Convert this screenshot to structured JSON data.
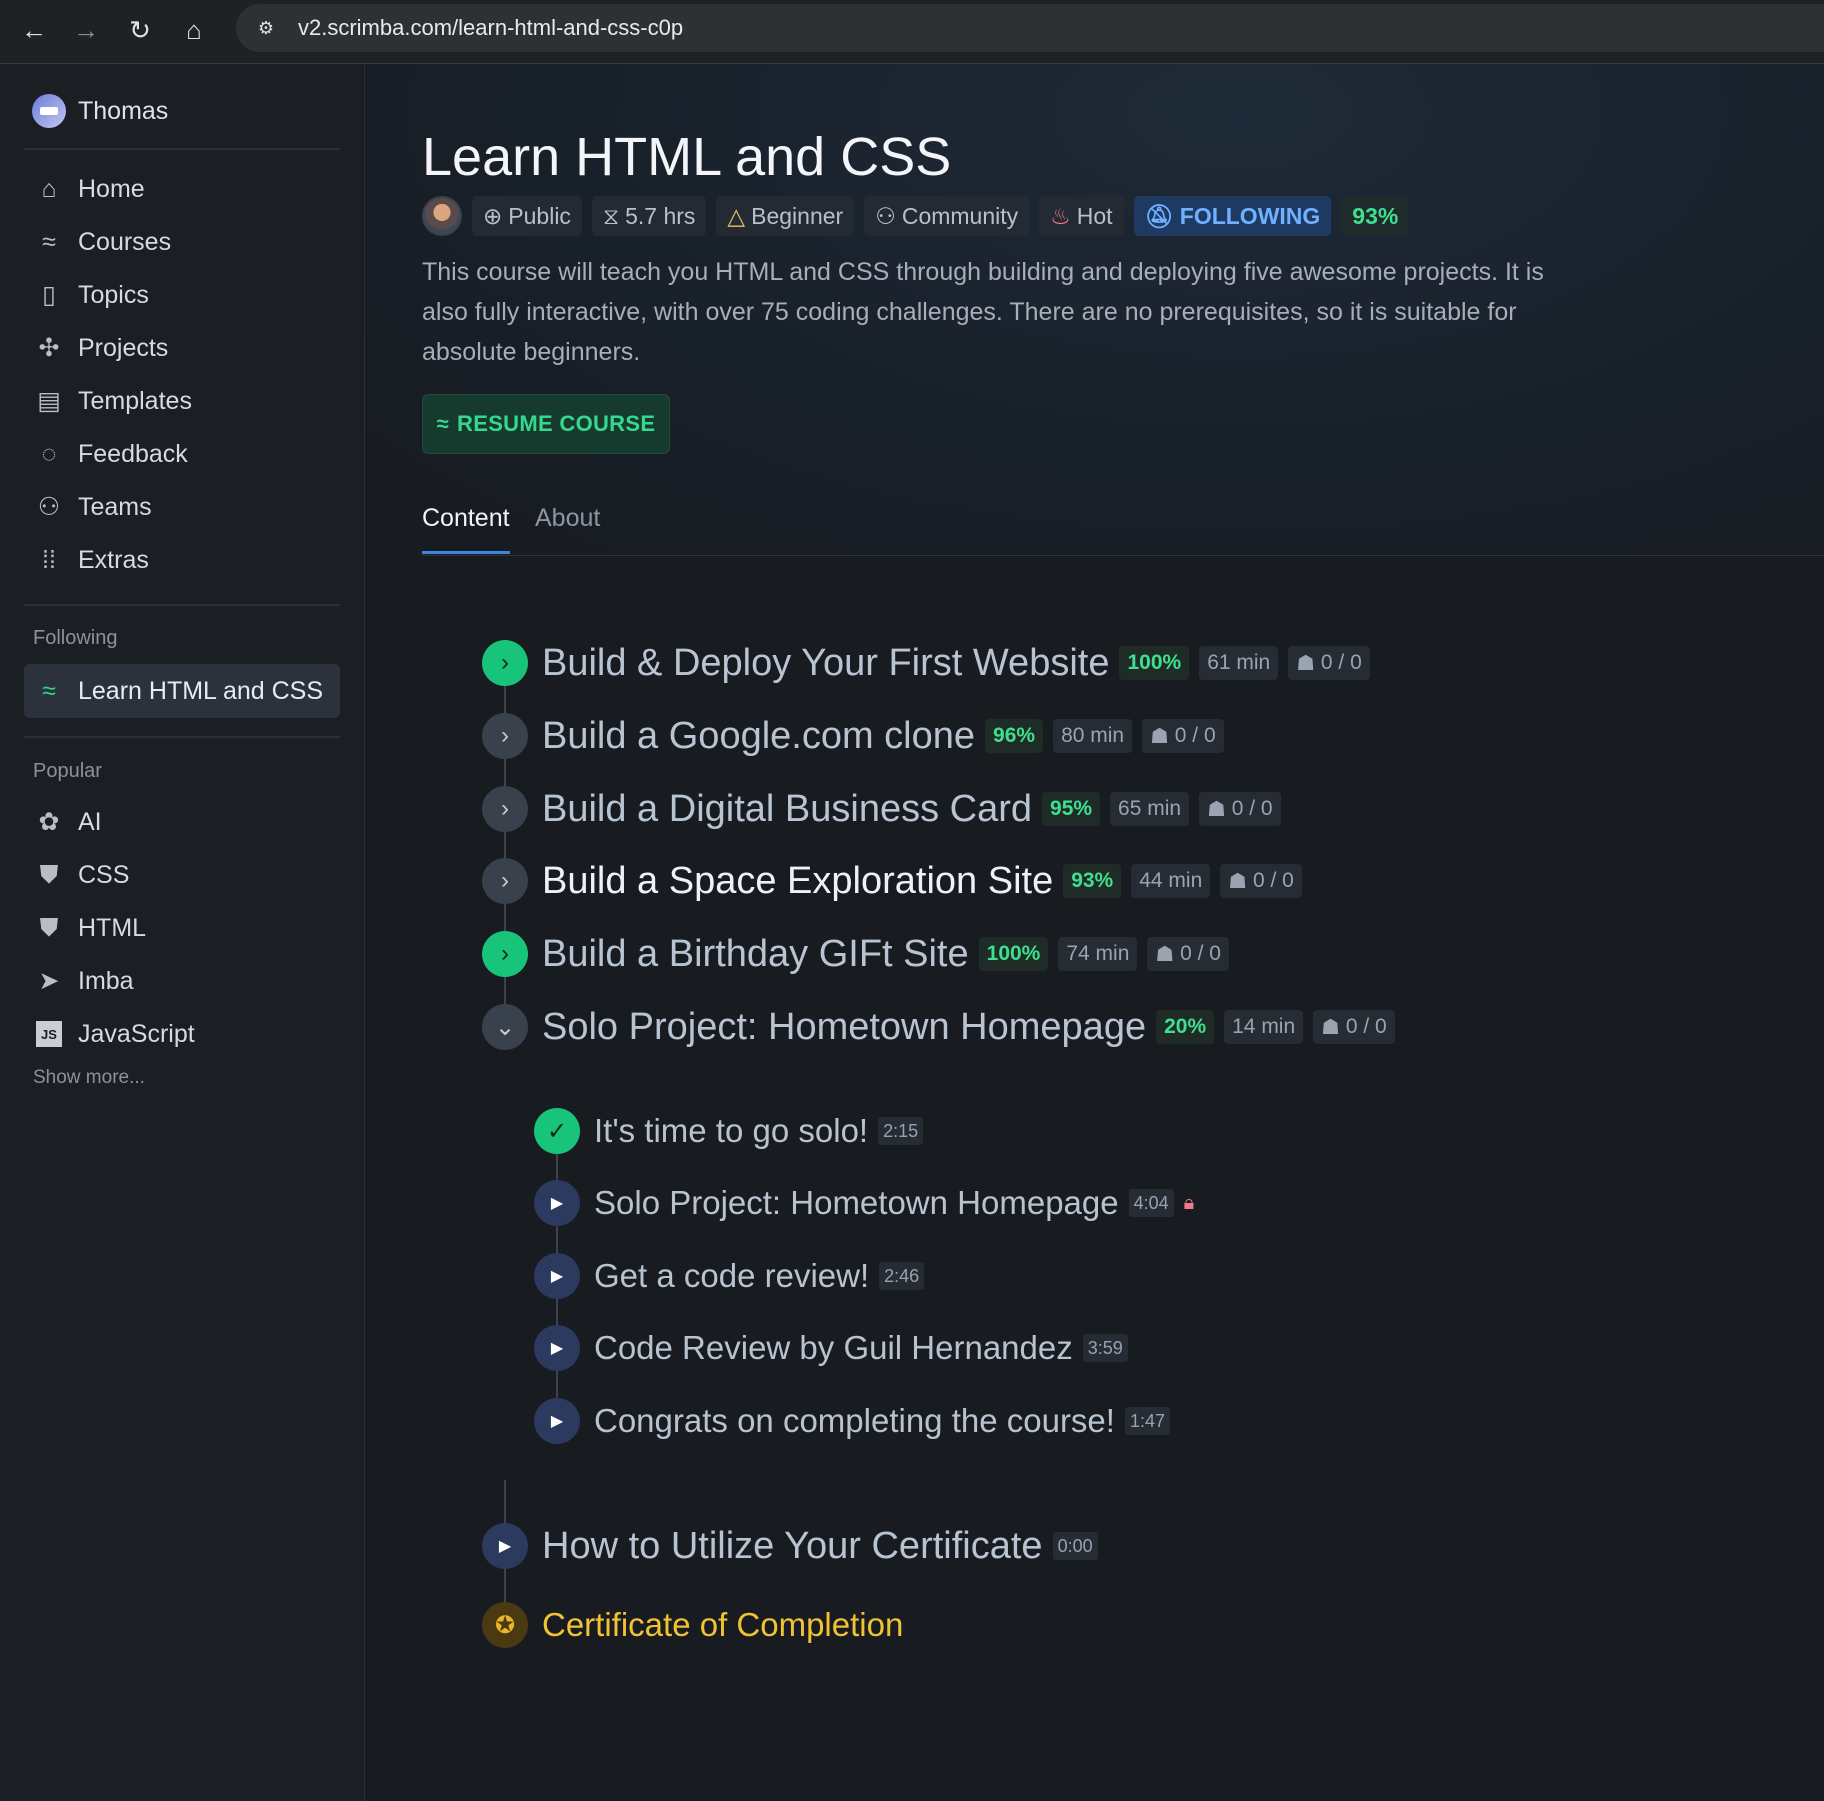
{
  "browser": {
    "url": "v2.scrimba.com/learn-html-and-css-c0p"
  },
  "sidebar": {
    "user": "Thomas",
    "nav": [
      {
        "label": "Home",
        "icon": "home-icon"
      },
      {
        "label": "Courses",
        "icon": "courses-icon"
      },
      {
        "label": "Topics",
        "icon": "topics-icon"
      },
      {
        "label": "Projects",
        "icon": "projects-icon"
      },
      {
        "label": "Templates",
        "icon": "templates-icon"
      },
      {
        "label": "Feedback",
        "icon": "feedback-icon"
      },
      {
        "label": "Teams",
        "icon": "teams-icon"
      },
      {
        "label": "Extras",
        "icon": "extras-icon"
      }
    ],
    "following_heading": "Following",
    "following": [
      {
        "label": "Learn HTML and CSS"
      }
    ],
    "popular_heading": "Popular",
    "popular": [
      {
        "label": "AI"
      },
      {
        "label": "CSS"
      },
      {
        "label": "HTML"
      },
      {
        "label": "Imba"
      },
      {
        "label": "JavaScript"
      }
    ],
    "show_more": "Show more..."
  },
  "course": {
    "title": "Learn HTML and CSS",
    "tags": {
      "visibility": "Public",
      "duration": "5.7 hrs",
      "level": "Beginner",
      "type": "Community",
      "hot": "Hot",
      "following": "FOLLOWING",
      "progress": "93%"
    },
    "description": "This course will teach you HTML and CSS through building and deploying five awesome projects. It is also fully interactive, with over 75 coding challenges. There are no prerequisites, so it is suitable for absolute beginners.",
    "resume": "RESUME COURSE",
    "tabs": [
      "Content",
      "About"
    ]
  },
  "sections": [
    {
      "name": "Build & Deploy Your First Website",
      "pct": "100%",
      "min": "61 min",
      "count": "0 / 0",
      "state": "done"
    },
    {
      "name": "Build a Google.com clone",
      "pct": "96%",
      "min": "80 min",
      "count": "0 / 0",
      "state": "collapsed"
    },
    {
      "name": "Build a Digital Business Card",
      "pct": "95%",
      "min": "65 min",
      "count": "0 / 0",
      "state": "collapsed"
    },
    {
      "name": "Build a Space Exploration Site",
      "pct": "93%",
      "min": "44 min",
      "count": "0 / 0",
      "state": "collapsed"
    },
    {
      "name": "Build a Birthday GIFt Site",
      "pct": "100%",
      "min": "74 min",
      "count": "0 / 0",
      "state": "done"
    },
    {
      "name": "Solo Project: Hometown Homepage",
      "pct": "20%",
      "min": "14 min",
      "count": "0 / 0",
      "state": "expanded"
    }
  ],
  "lessons": [
    {
      "name": "It's time to go solo!",
      "dur": "2:15",
      "state": "done"
    },
    {
      "name": "Solo Project: Hometown Homepage",
      "dur": "4:04",
      "state": "play",
      "locked": true
    },
    {
      "name": "Get a code review!",
      "dur": "2:46",
      "state": "play"
    },
    {
      "name": "Code Review by Guil Hernandez",
      "dur": "3:59",
      "state": "play"
    },
    {
      "name": "Congrats on completing the course!",
      "dur": "1:47",
      "state": "play"
    }
  ],
  "final": {
    "name": "How to Utilize Your Certificate",
    "dur": "0:00",
    "certificate": "Certificate of Completion"
  },
  "colors": {
    "accent_green": "#3ee08f",
    "following_blue": "#6fb1ff",
    "certificate_gold": "#f1c232"
  }
}
